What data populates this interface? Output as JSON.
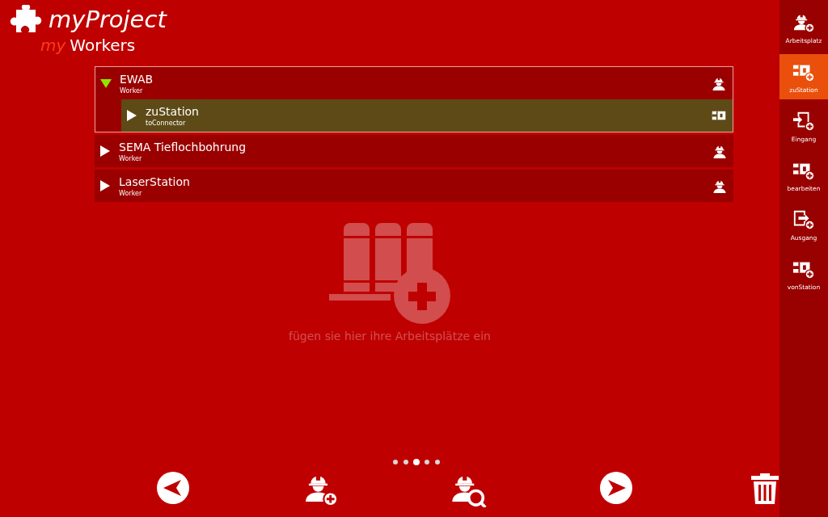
{
  "header": {
    "title": "myProject",
    "subtitle_prefix": "my",
    "subtitle": "Workers"
  },
  "tree": [
    {
      "label": "EWAB",
      "type_label": "Worker",
      "kind": "worker",
      "expanded": true,
      "selected": false,
      "children": [
        {
          "label": "zuStation",
          "type_label": "toConnector",
          "kind": "connector",
          "expanded": false,
          "selected": true
        }
      ]
    },
    {
      "label": "SEMA Tieflochbohrung",
      "type_label": "Worker",
      "kind": "worker",
      "expanded": false,
      "selected": false
    },
    {
      "label": "LaserStation",
      "type_label": "Worker",
      "kind": "worker",
      "expanded": false,
      "selected": false
    }
  ],
  "empty_hint": "fügen sie hier ihre Arbeitsplätze ein",
  "pager": [
    {
      "selected": false
    },
    {
      "selected": false
    },
    {
      "selected": true
    },
    {
      "selected": false
    },
    {
      "selected": false
    }
  ],
  "sidebar": [
    {
      "label": "Arbeitsplatz",
      "kind": "worker",
      "selected": false
    },
    {
      "label": "zuStation",
      "kind": "connector",
      "selected": true
    },
    {
      "label": "Eingang",
      "kind": "input",
      "selected": false
    },
    {
      "label": "bearbeiten",
      "kind": "connector",
      "selected": false
    },
    {
      "label": "Ausgang",
      "kind": "output",
      "selected": false
    },
    {
      "label": "vonStation",
      "kind": "connector",
      "selected": false
    }
  ]
}
